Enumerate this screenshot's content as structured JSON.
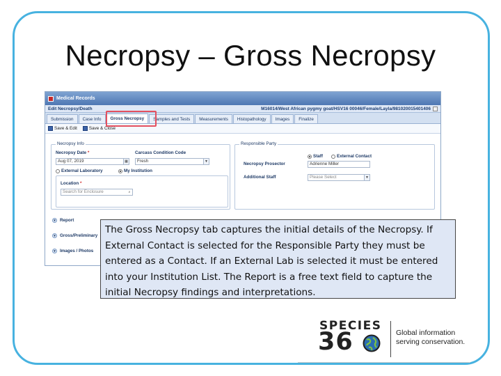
{
  "slide": {
    "title": "Necropsy – Gross Necropsy"
  },
  "app": {
    "window_title": "Medical Records",
    "header_left": "Edit Necropsy/Death",
    "header_right": "M16014/West African pygmy goat/HSV16 00046/Female/Layla/981020015401406",
    "tabs": [
      {
        "label": "Submission"
      },
      {
        "label": "Case Info"
      },
      {
        "label": "Gross Necropsy"
      },
      {
        "label": "Samples and Tests"
      },
      {
        "label": "Measurements"
      },
      {
        "label": "Histopathology"
      },
      {
        "label": "Images"
      },
      {
        "label": "Finalize"
      }
    ],
    "toolbar": {
      "save_edit": "Save & Edit",
      "save_close": "Save & Close"
    },
    "necropsy_info": {
      "legend": "Necropsy Info",
      "date_label": "Necropsy Date",
      "date_value": "Aug 07, 2019",
      "carcass_label": "Carcass Condition Code",
      "carcass_value": "Fresh",
      "external_lab": "External Laboratory",
      "my_institution": "My Institution",
      "location_label": "Location",
      "location_placeholder": "Search for Enclosure"
    },
    "responsible_party": {
      "legend": "Responsible Party",
      "staff": "Staff",
      "external_contact": "External Contact",
      "prosector_label": "Necropsy Prosector",
      "prosector_value": "Adrienne Miller",
      "additional_label": "Additional Staff",
      "additional_placeholder": "Please Select"
    },
    "sections": [
      {
        "label": "Report"
      },
      {
        "label": "Gross/Preliminary"
      },
      {
        "label": "Images / Photos"
      }
    ],
    "required_mark": "*"
  },
  "callout": {
    "text": "The Gross Necropsy tab captures the initial details of the Necropsy. If External Contact is selected for the Responsible Party they must be entered as a Contact. If an External Lab is selected it must be entered into your Institution List. The Report is a free text field to capture the initial Necropsy findings and interpretations."
  },
  "logo": {
    "word": "SPECIES",
    "number_left": "36",
    "tagline_line1": "Global information",
    "tagline_line2": "serving conservation."
  },
  "colors": {
    "frame": "#47b2e0",
    "highlight": "#e4505f",
    "callout_bg": "#dfe7f5"
  }
}
